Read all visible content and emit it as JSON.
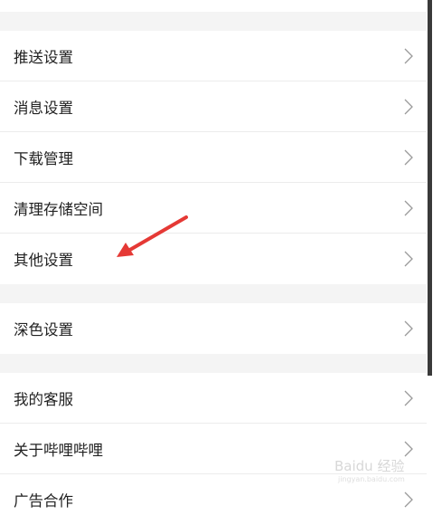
{
  "settings": {
    "group1": [
      {
        "label": "推送设置"
      },
      {
        "label": "消息设置"
      },
      {
        "label": "下载管理"
      },
      {
        "label": "清理存储空间"
      },
      {
        "label": "其他设置"
      }
    ],
    "group2": [
      {
        "label": "深色设置"
      }
    ],
    "group3": [
      {
        "label": "我的客服"
      },
      {
        "label": "关于哔哩哔哩"
      },
      {
        "label": "广告合作"
      }
    ]
  },
  "annotation": {
    "arrow_color": "#e53935",
    "points_to": "其他设置"
  },
  "watermark": {
    "text": "Baidu 经验",
    "subtext": "jingyan.baidu.com"
  }
}
